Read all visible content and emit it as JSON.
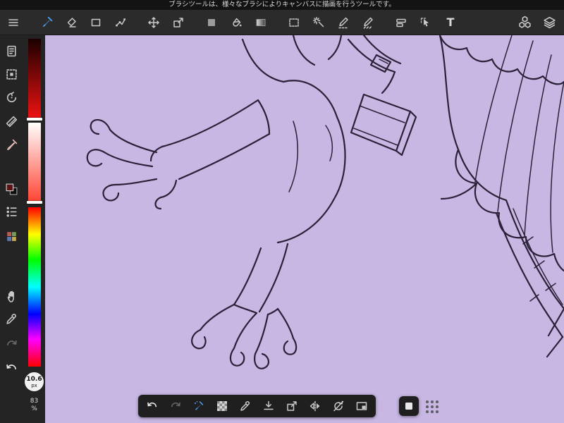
{
  "app": {
    "theme_color": "#262626",
    "accent_color": "#4da3f7"
  },
  "tooltip_bar": {
    "text": "ブラシツールは、様々なブラシによりキャンバスに描画を行うツールです。"
  },
  "toolbar": {
    "active_tool": "brush",
    "text_tool_glyph": "T",
    "items": [
      {
        "name": "menu"
      },
      {
        "name": "brush",
        "active": true
      },
      {
        "name": "eraser"
      },
      {
        "name": "shape"
      },
      {
        "name": "polyline"
      },
      {
        "name": "move"
      },
      {
        "name": "transform"
      },
      {
        "name": "fill"
      },
      {
        "name": "bucket"
      },
      {
        "name": "gradient"
      },
      {
        "name": "select"
      },
      {
        "name": "magic-wand"
      },
      {
        "name": "select-pen"
      },
      {
        "name": "select-eraser"
      },
      {
        "name": "command-bar"
      },
      {
        "name": "operation-select"
      },
      {
        "name": "text"
      },
      {
        "name": "material"
      },
      {
        "name": "layer"
      }
    ]
  },
  "sidebar": {
    "items": [
      {
        "name": "canvas"
      },
      {
        "name": "select"
      },
      {
        "name": "rotate"
      },
      {
        "name": "ruler"
      },
      {
        "name": "blend-brush"
      },
      {
        "name": "color-swatch",
        "foreground": "#5c1214",
        "background": "#0d0d0d"
      },
      {
        "name": "brush-list"
      },
      {
        "name": "palette"
      },
      {
        "name": "hand"
      },
      {
        "name": "eyedropper"
      },
      {
        "name": "redo",
        "enabled": false
      },
      {
        "name": "undo",
        "enabled": true
      }
    ]
  },
  "color_panel": {
    "value_slider": {
      "from": "#1c0000",
      "to": "#ee1111"
    },
    "tint_slider": {
      "from": "#ffffff",
      "to": "#ff4433"
    },
    "hue_slider": [
      "#ff0000",
      "#ffff00",
      "#00ff00",
      "#00ffff",
      "#0000ff",
      "#ff00ff",
      "#ff0000"
    ],
    "brush_size": {
      "value": "10.6",
      "unit": "px"
    },
    "zoom": {
      "value": "83",
      "unit": "%"
    }
  },
  "canvas": {
    "background_color": "#c8b7e3",
    "line_color": "#2a2138",
    "artwork_description": "Line-art sketch of a harpy figure: two bird legs with clawed talons, a folded knee, a belt strap with buckle and hanging pouch, and a large feathered wing with long tail feathers on the right side."
  },
  "bottom_toolbar": {
    "items": [
      {
        "name": "undo",
        "enabled": true
      },
      {
        "name": "redo",
        "enabled": false
      },
      {
        "name": "brush-settings",
        "active": true
      },
      {
        "name": "transparent-background"
      },
      {
        "name": "eyedropper"
      },
      {
        "name": "save"
      },
      {
        "name": "export"
      },
      {
        "name": "flip-horizontal"
      },
      {
        "name": "reset-rotation"
      },
      {
        "name": "reference-window"
      },
      {
        "name": "floating-window"
      },
      {
        "name": "drag-handle"
      }
    ]
  }
}
